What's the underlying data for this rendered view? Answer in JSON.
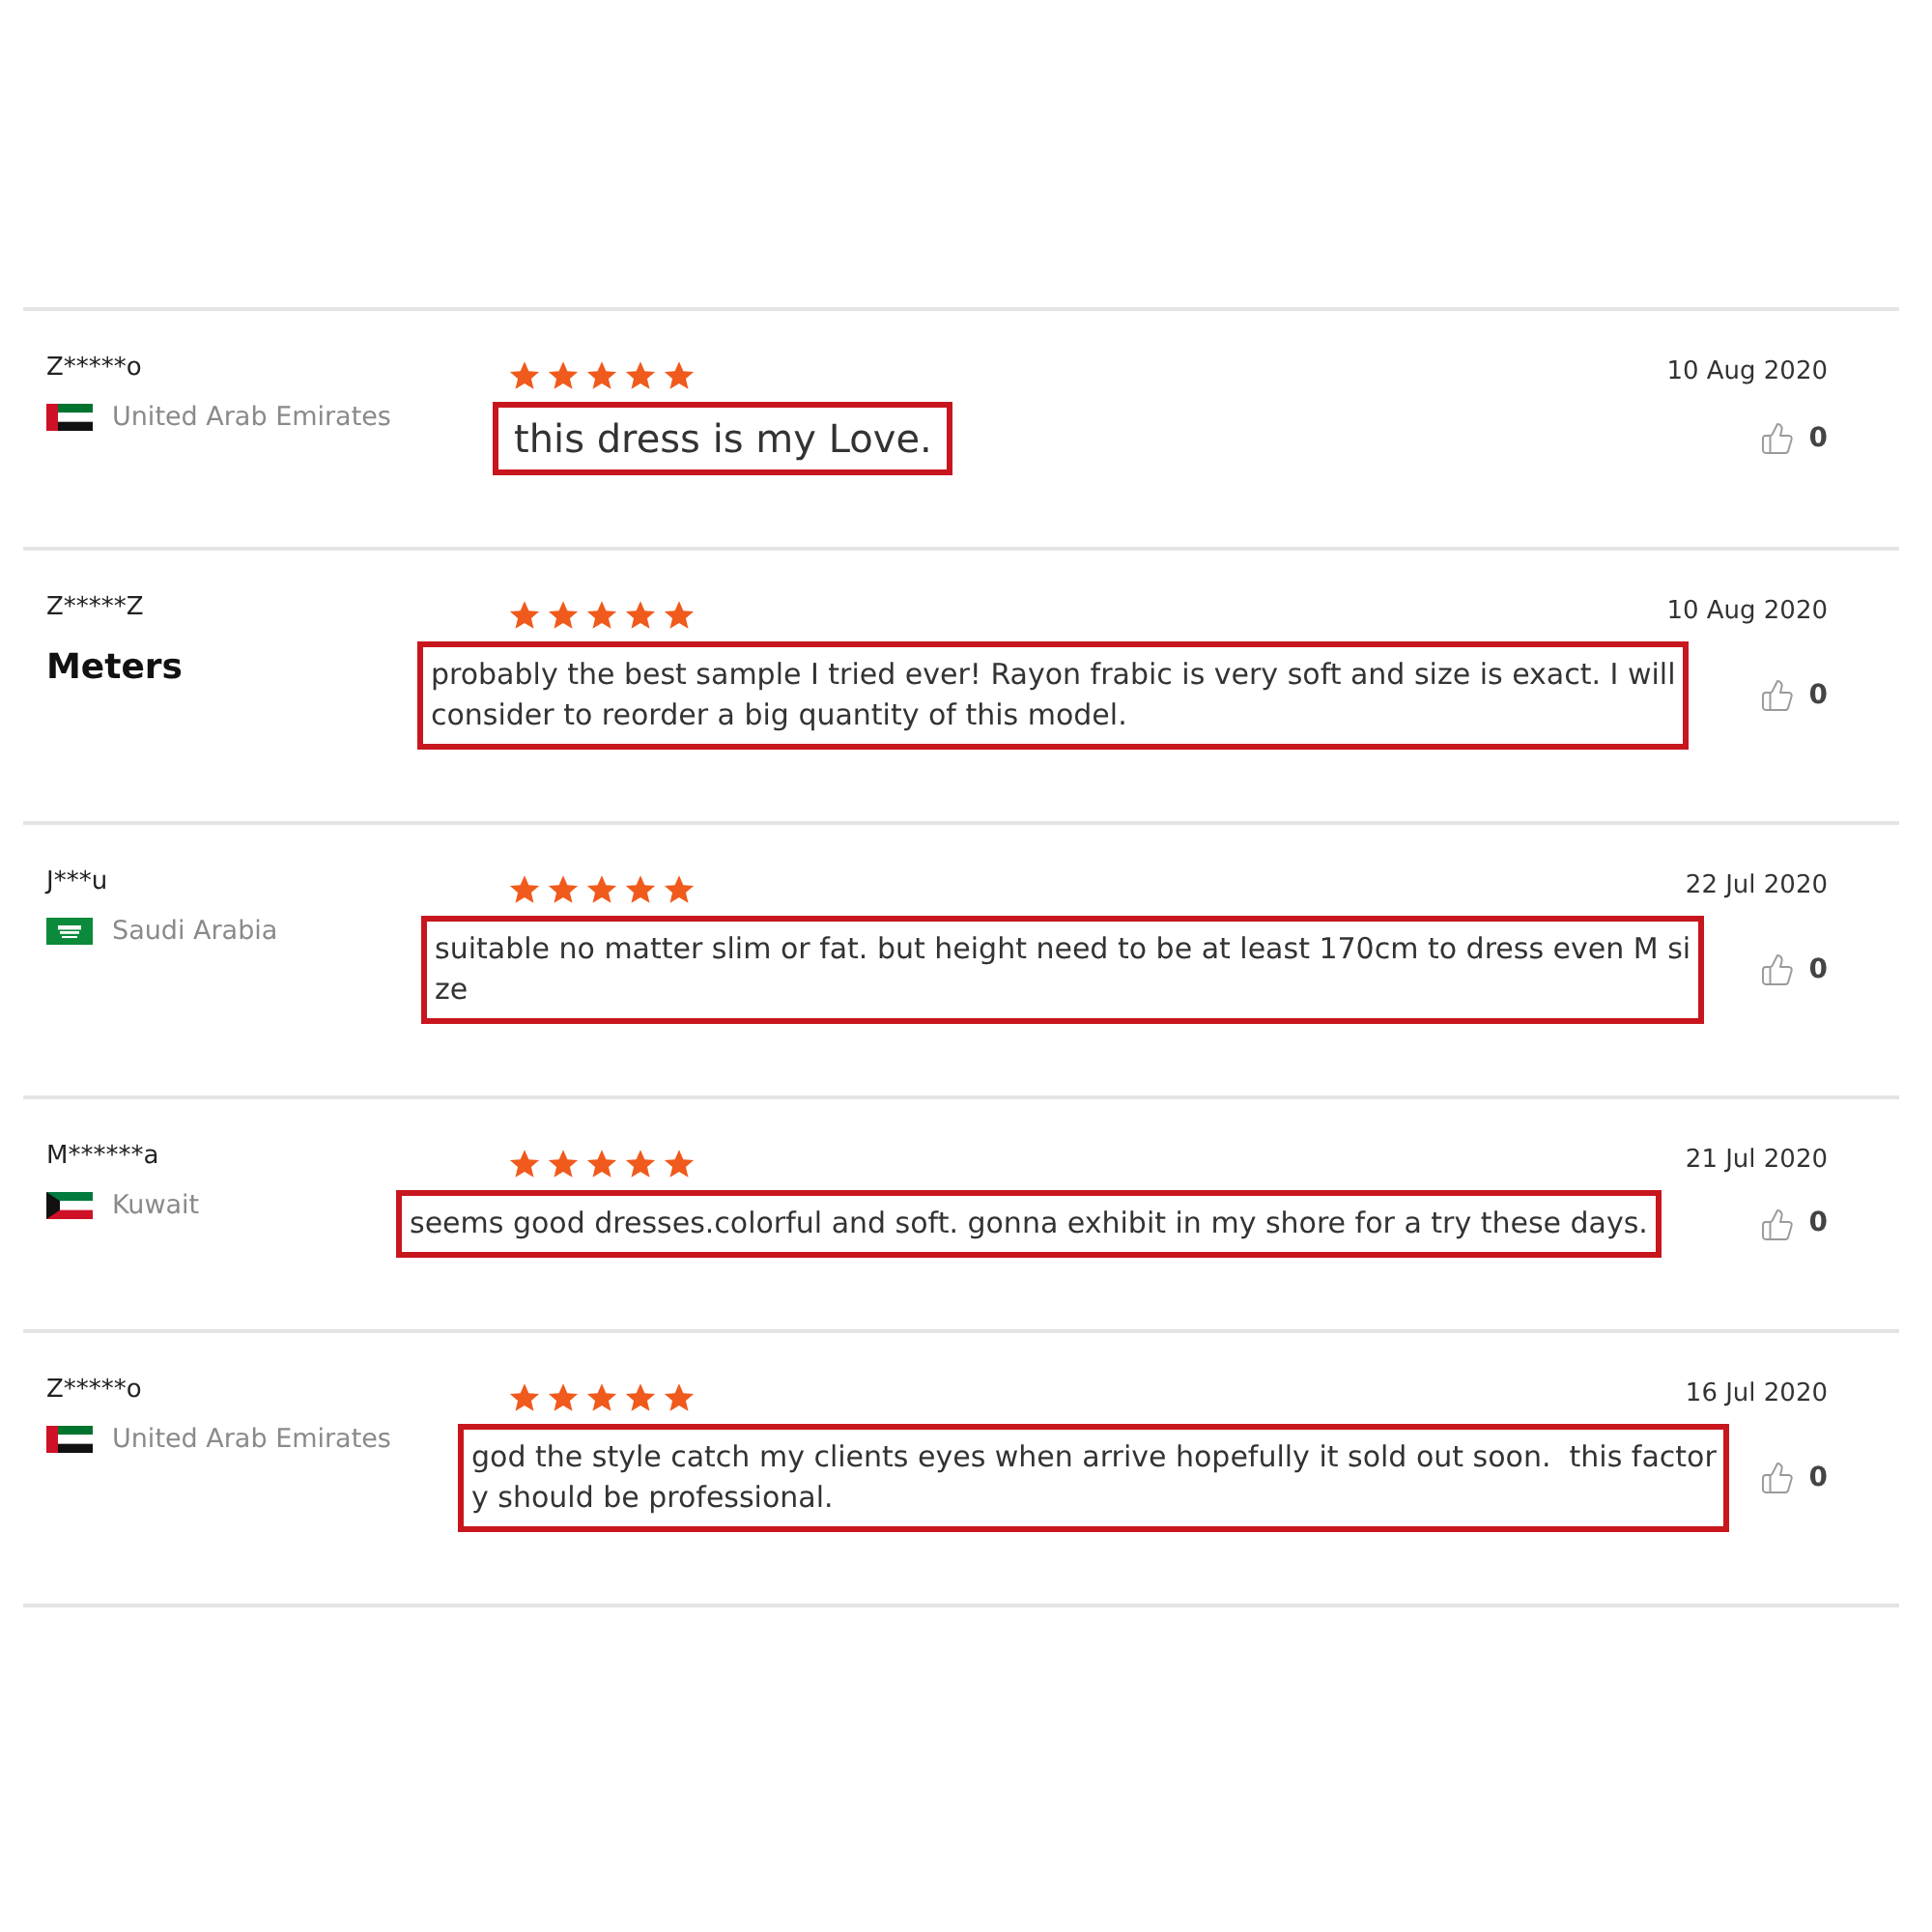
{
  "reviews": [
    {
      "name": "Z*****o",
      "origin": {
        "kind": "country",
        "flag": {
          "kind": "ae"
        },
        "label": "United Arab Emirates"
      },
      "stars": 5,
      "text_lines": [
        "this dress is my Love."
      ],
      "date": "10 Aug 2020",
      "likes": "0"
    },
    {
      "name": "Z*****Z",
      "origin": {
        "kind": "note",
        "label": "Meters"
      },
      "stars": 5,
      "text_lines": [
        "probably the best sample I tried ever! Rayon frabic is very soft and size is exact. I will",
        "consider to reorder a big quantity of this model."
      ],
      "date": "10 Aug 2020",
      "likes": "0"
    },
    {
      "name": "J***u",
      "origin": {
        "kind": "country",
        "flag": {
          "kind": "sa"
        },
        "label": "Saudi Arabia"
      },
      "stars": 5,
      "text_lines": [
        "suitable no matter slim or fat. but height need to be at least 170cm to dress even M si",
        "ze"
      ],
      "date": "22 Jul 2020",
      "likes": "0"
    },
    {
      "name": "M******a",
      "origin": {
        "kind": "country",
        "flag": {
          "kind": "kw"
        },
        "label": "Kuwait"
      },
      "stars": 5,
      "text_lines": [
        "seems good dresses.colorful and soft. gonna exhibit in my shore for a try these days."
      ],
      "date": "21 Jul 2020",
      "likes": "0"
    },
    {
      "name": "Z*****o",
      "origin": {
        "kind": "country",
        "flag": {
          "kind": "ae"
        },
        "label": "United Arab Emirates"
      },
      "stars": 5,
      "text_lines": [
        "god the style catch my clients eyes when arrive hopefully it sold out soon.  this factor",
        "y should be professional."
      ],
      "date": "16 Jul 2020",
      "likes": "0"
    }
  ]
}
